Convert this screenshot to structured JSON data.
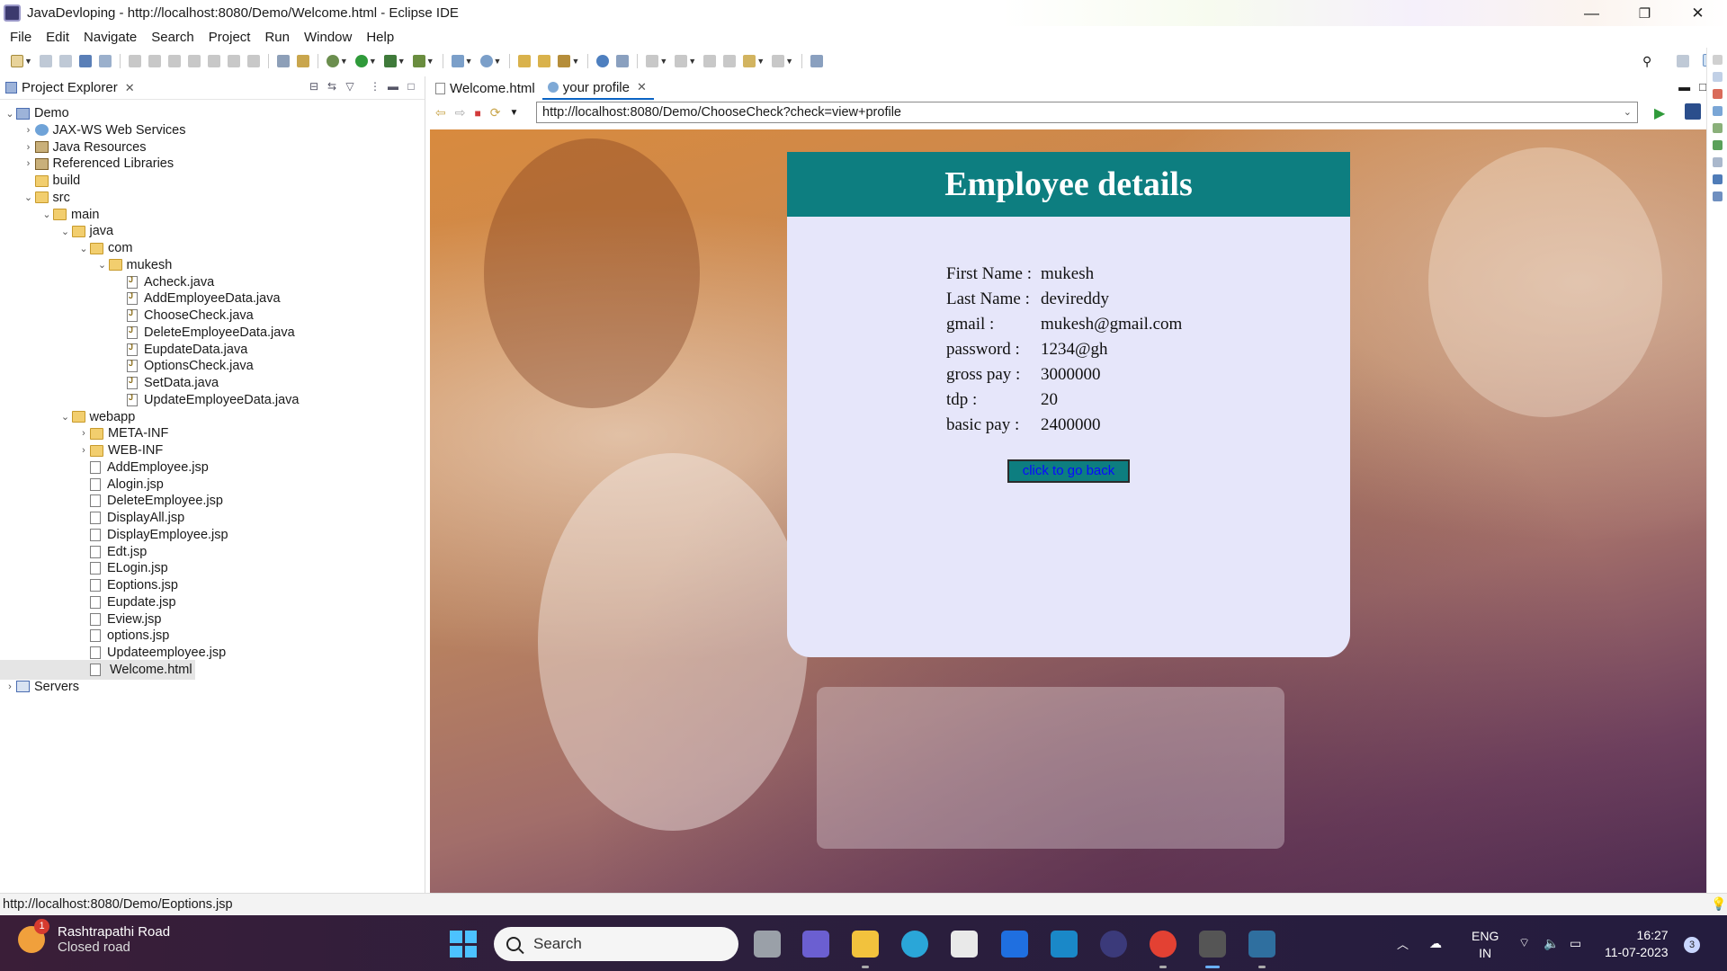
{
  "window": {
    "title": "JavaDevloping - http://localhost:8080/Demo/Welcome.html - Eclipse IDE",
    "minimize": "—",
    "restore": "❐",
    "close": "✕"
  },
  "menu": [
    "File",
    "Edit",
    "Navigate",
    "Search",
    "Project",
    "Run",
    "Window",
    "Help"
  ],
  "project_explorer": {
    "tab_label": "Project Explorer",
    "tree": [
      {
        "label": "Demo",
        "depth": 0,
        "chevron": "v",
        "icon": "project-icon"
      },
      {
        "label": "JAX-WS Web Services",
        "depth": 1,
        "chevron": ">",
        "icon": "web-services-icon"
      },
      {
        "label": "Java Resources",
        "depth": 1,
        "chevron": ">",
        "icon": "java-resources-icon"
      },
      {
        "label": "Referenced Libraries",
        "depth": 1,
        "chevron": ">",
        "icon": "library-icon"
      },
      {
        "label": "build",
        "depth": 1,
        "chevron": "",
        "icon": "folder-icon"
      },
      {
        "label": "src",
        "depth": 1,
        "chevron": "v",
        "icon": "folder-icon"
      },
      {
        "label": "main",
        "depth": 2,
        "chevron": "v",
        "icon": "folder-icon"
      },
      {
        "label": "java",
        "depth": 3,
        "chevron": "v",
        "icon": "folder-icon"
      },
      {
        "label": "com",
        "depth": 4,
        "chevron": "v",
        "icon": "folder-icon"
      },
      {
        "label": "mukesh",
        "depth": 5,
        "chevron": "v",
        "icon": "folder-icon"
      },
      {
        "label": "Acheck.java",
        "depth": 6,
        "chevron": "",
        "icon": "java-file-icon"
      },
      {
        "label": "AddEmployeeData.java",
        "depth": 6,
        "chevron": "",
        "icon": "java-file-icon"
      },
      {
        "label": "ChooseCheck.java",
        "depth": 6,
        "chevron": "",
        "icon": "java-file-icon"
      },
      {
        "label": "DeleteEmployeeData.java",
        "depth": 6,
        "chevron": "",
        "icon": "java-file-icon"
      },
      {
        "label": "EupdateData.java",
        "depth": 6,
        "chevron": "",
        "icon": "java-file-icon"
      },
      {
        "label": "OptionsCheck.java",
        "depth": 6,
        "chevron": "",
        "icon": "java-file-icon"
      },
      {
        "label": "SetData.java",
        "depth": 6,
        "chevron": "",
        "icon": "java-file-icon"
      },
      {
        "label": "UpdateEmployeeData.java",
        "depth": 6,
        "chevron": "",
        "icon": "java-file-icon"
      },
      {
        "label": "webapp",
        "depth": 3,
        "chevron": "v",
        "icon": "folder-icon"
      },
      {
        "label": "META-INF",
        "depth": 4,
        "chevron": ">",
        "icon": "folder-icon"
      },
      {
        "label": "WEB-INF",
        "depth": 4,
        "chevron": ">",
        "icon": "folder-icon"
      },
      {
        "label": "AddEmployee.jsp",
        "depth": 4,
        "chevron": "",
        "icon": "jsp-file-icon"
      },
      {
        "label": "Alogin.jsp",
        "depth": 4,
        "chevron": "",
        "icon": "jsp-file-icon"
      },
      {
        "label": "DeleteEmployee.jsp",
        "depth": 4,
        "chevron": "",
        "icon": "jsp-file-icon"
      },
      {
        "label": "DisplayAll.jsp",
        "depth": 4,
        "chevron": "",
        "icon": "jsp-file-icon"
      },
      {
        "label": "DisplayEmployee.jsp",
        "depth": 4,
        "chevron": "",
        "icon": "jsp-file-icon"
      },
      {
        "label": "Edt.jsp",
        "depth": 4,
        "chevron": "",
        "icon": "jsp-file-icon"
      },
      {
        "label": "ELogin.jsp",
        "depth": 4,
        "chevron": "",
        "icon": "jsp-file-icon"
      },
      {
        "label": "Eoptions.jsp",
        "depth": 4,
        "chevron": "",
        "icon": "jsp-file-icon"
      },
      {
        "label": "Eupdate.jsp",
        "depth": 4,
        "chevron": "",
        "icon": "jsp-file-icon"
      },
      {
        "label": "Eview.jsp",
        "depth": 4,
        "chevron": "",
        "icon": "jsp-file-icon"
      },
      {
        "label": "options.jsp",
        "depth": 4,
        "chevron": "",
        "icon": "jsp-file-icon"
      },
      {
        "label": "Updateemployee.jsp",
        "depth": 4,
        "chevron": "",
        "icon": "jsp-file-icon"
      },
      {
        "label": "Welcome.html",
        "depth": 4,
        "chevron": "",
        "icon": "html-file-icon",
        "selected": true
      },
      {
        "label": "Servers",
        "depth": 0,
        "chevron": ">",
        "icon": "servers-icon"
      }
    ]
  },
  "editor": {
    "tabs": [
      {
        "label": "Welcome.html",
        "active": false
      },
      {
        "label": "your profile",
        "active": true
      }
    ],
    "url": "http://localhost:8080/Demo/ChooseCheck?check=view+profile"
  },
  "page": {
    "heading": "Employee details",
    "fields": [
      {
        "label": "First Name :",
        "value": "mukesh"
      },
      {
        "label": "Last Name :",
        "value": "devireddy"
      },
      {
        "label": "gmail :",
        "value": "mukesh@gmail.com"
      },
      {
        "label": "password :",
        "value": "1234@gh"
      },
      {
        "label": "gross pay :",
        "value": "3000000"
      },
      {
        "label": "tdp :",
        "value": "20"
      },
      {
        "label": "basic pay :",
        "value": "2400000"
      }
    ],
    "back_button": "click to go back",
    "header_color": "#0d7e80",
    "card_color": "#e6e6fa"
  },
  "status_bar": {
    "text": "http://localhost:8080/Demo/Eoptions.jsp"
  },
  "taskbar": {
    "weather": {
      "line1": "Rashtrapathi Road",
      "line2": "Closed road",
      "badge": "1"
    },
    "search_label": "Search",
    "language": {
      "line1": "ENG",
      "line2": "IN"
    },
    "time": "16:27",
    "date": "11-07-2023",
    "notifications": "3"
  }
}
